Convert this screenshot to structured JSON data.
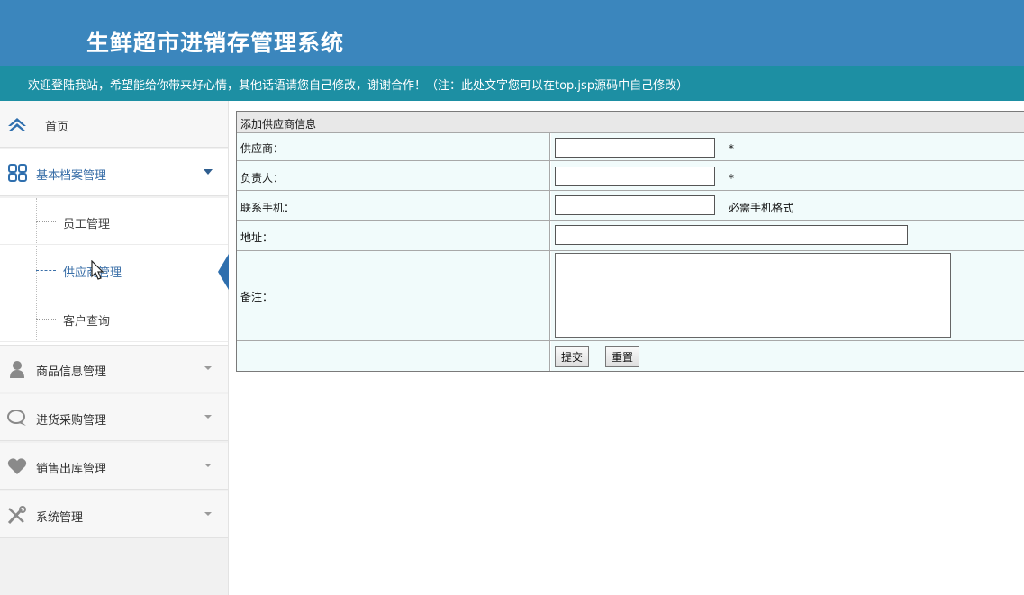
{
  "header": {
    "app_title": "生鲜超市进销存管理系统",
    "welcome_text": "欢迎登陆我站，希望能给你带来好心情，其他话语请您自己修改，谢谢合作！（注：此处文字您可以在top.jsp源码中自己修改）"
  },
  "sidebar": {
    "home": {
      "label": "首页",
      "icon": "home-icon"
    },
    "items": [
      {
        "label": "基本档案管理",
        "icon": "grid-icon",
        "expanded": true
      },
      {
        "label": "商品信息管理",
        "icon": "user-icon",
        "expanded": false
      },
      {
        "label": "进货采购管理",
        "icon": "chat-icon",
        "expanded": false
      },
      {
        "label": "销售出库管理",
        "icon": "heart-icon",
        "expanded": false
      },
      {
        "label": "系统管理",
        "icon": "tools-icon",
        "expanded": false
      }
    ],
    "submenu": [
      {
        "label": "员工管理",
        "active": false
      },
      {
        "label": "供应商管理",
        "active": true
      },
      {
        "label": "客户查询",
        "active": false
      }
    ]
  },
  "form": {
    "caption": "添加供应商信息",
    "fields": {
      "supplier": {
        "label": "供应商：",
        "value": "",
        "required_mark": "*"
      },
      "manager": {
        "label": "负责人：",
        "value": "",
        "required_mark": "*"
      },
      "phone": {
        "label": "联系手机：",
        "value": "",
        "hint": "必需手机格式"
      },
      "address": {
        "label": "地址：",
        "value": ""
      },
      "remark": {
        "label": "备注：",
        "value": ""
      }
    },
    "buttons": {
      "submit": "提交",
      "reset": "重置"
    }
  },
  "colors": {
    "header_bg": "#3b86bd",
    "welcome_bg": "#1d8fa3",
    "active_text": "#3a6fa8",
    "form_row_bg": "#f1fbfb"
  }
}
